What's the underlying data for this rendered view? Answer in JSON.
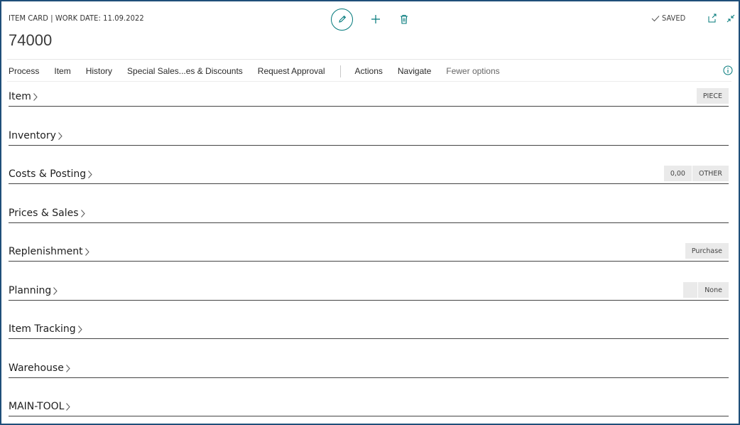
{
  "header": {
    "caption": "ITEM CARD | WORK DATE: 11.09.2022",
    "record_title": "74000",
    "status": "SAVED",
    "icons": [
      "edit-icon",
      "plus-icon",
      "trash-icon",
      "check-icon",
      "open-new-window-icon",
      "collapse-icon"
    ]
  },
  "actions": {
    "items": [
      "Process",
      "Item",
      "History",
      "Special Sales...es & Discounts",
      "Request Approval"
    ],
    "items2": [
      "Actions",
      "Navigate"
    ],
    "fewer": "Fewer options"
  },
  "sections": [
    {
      "title": "Item",
      "chips": [
        "PIECE"
      ]
    },
    {
      "title": "Inventory",
      "chips": []
    },
    {
      "title": "Costs & Posting",
      "chips": [
        "0,00",
        "OTHER"
      ]
    },
    {
      "title": "Prices & Sales",
      "chips": []
    },
    {
      "title": "Replenishment",
      "chips": [
        "Purchase"
      ]
    },
    {
      "title": "Planning",
      "chips": [
        "",
        "None"
      ]
    },
    {
      "title": "Item Tracking",
      "chips": []
    },
    {
      "title": "Warehouse",
      "chips": []
    },
    {
      "title": "MAIN-TOOL",
      "chips": []
    }
  ],
  "colors": {
    "accent": "#00787a",
    "frame": "#1f4e79",
    "chip_bg": "#eaeaea"
  }
}
